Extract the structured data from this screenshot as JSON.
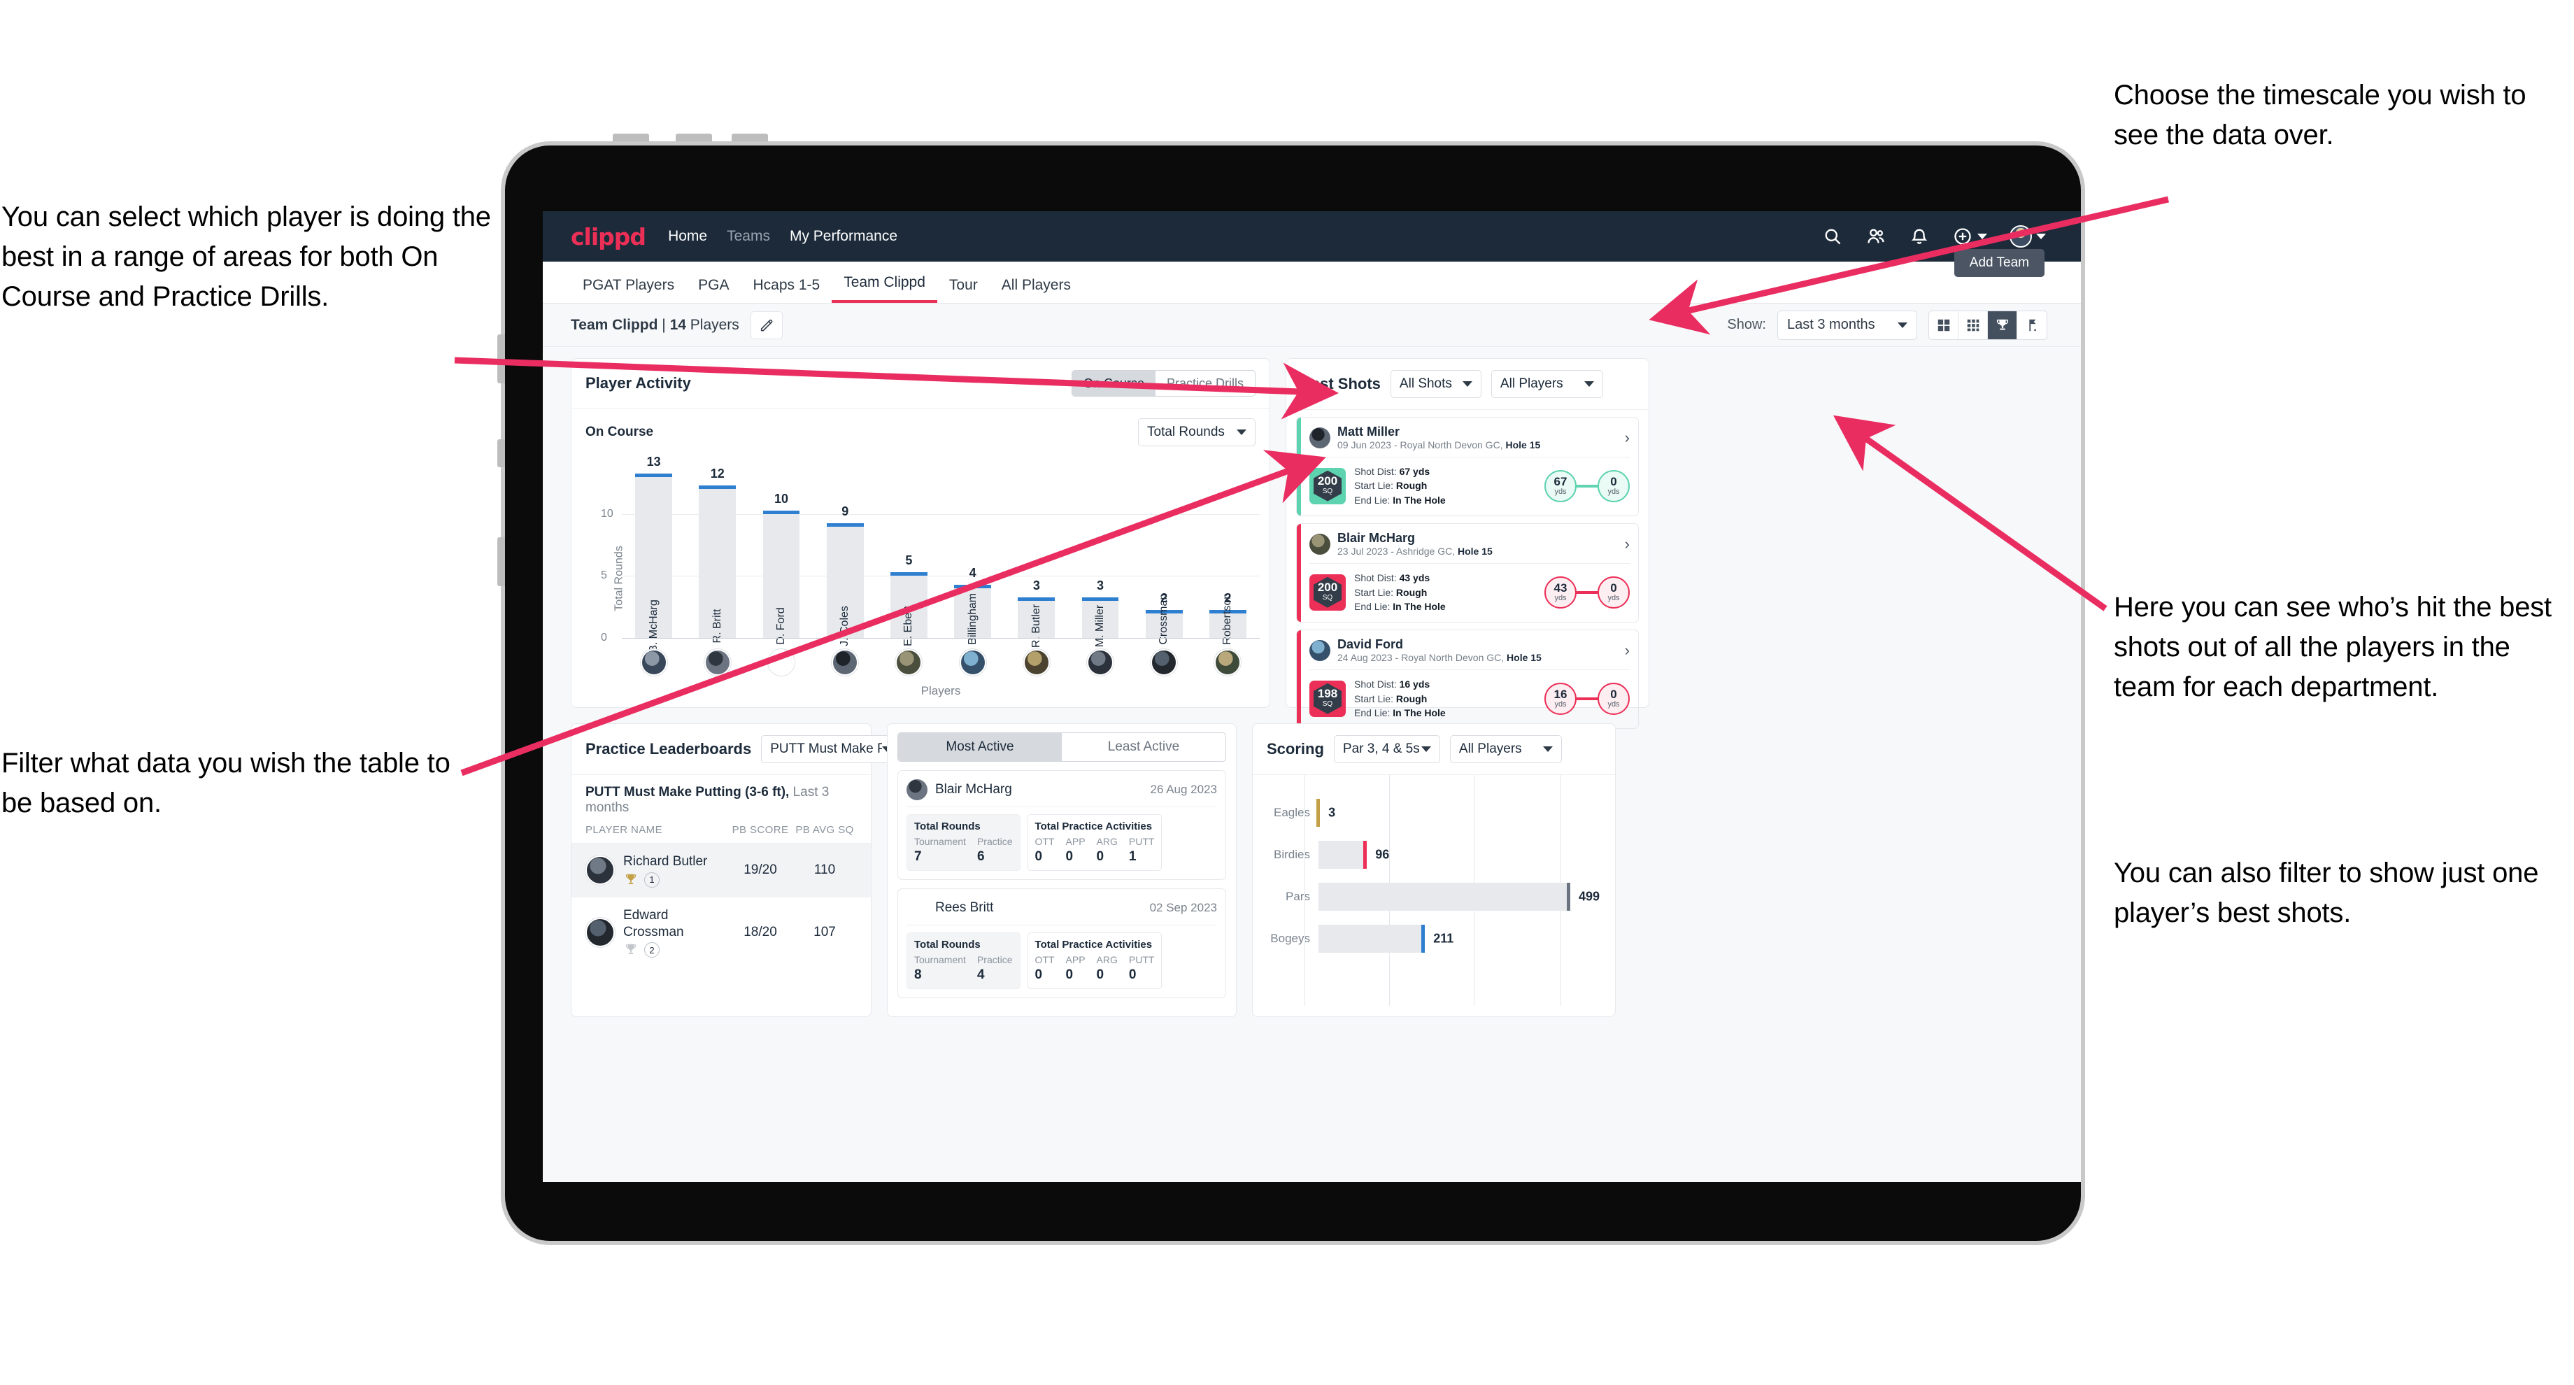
{
  "annotations": {
    "top_left": "You can select which player is doing the best in a range of areas for both On Course and Practice Drills.",
    "bottom_left": "Filter what data you wish the table to be based on.",
    "top_right": "Choose the timescale you wish to see the data over.",
    "right_1": "Here you can see who’s hit the best shots out of all the players in the team for each department.",
    "right_2": "You can also filter to show just one player’s best shots."
  },
  "colors": {
    "brand_pink": "#ec2f57",
    "nav_dark": "#1c2a3a",
    "bar_blue": "#2f7fd1",
    "teal": "#5ed3b0",
    "gold": "#c3a046",
    "arrow_pink": "#ea2d60"
  },
  "topnav": {
    "logo": "clippd",
    "links": [
      {
        "label": "Home",
        "dim": false
      },
      {
        "label": "Teams",
        "dim": true
      },
      {
        "label": "My Performance",
        "dim": false
      }
    ],
    "icons": [
      "search-icon",
      "people-icon",
      "bell-icon",
      "plus-circle-icon",
      "avatar-icon"
    ]
  },
  "tabs": {
    "items": [
      {
        "label": "PGAT Players",
        "active": false
      },
      {
        "label": "PGA",
        "active": false
      },
      {
        "label": "Hcaps 1-5",
        "active": false
      },
      {
        "label": "Team Clippd",
        "active": true
      },
      {
        "label": "Tour",
        "active": false
      },
      {
        "label": "All Players",
        "active": false
      }
    ],
    "add_team_tooltip": "Add Team"
  },
  "subbar": {
    "team_name": "Team Clippd",
    "separator": " | ",
    "player_count": "14",
    "players_word": " Players",
    "show_label": "Show:",
    "timescale": "Last 3 months",
    "view_buttons": [
      "grid-large-icon",
      "grid-small-icon",
      "trophy-icon",
      "flag-icon"
    ],
    "active_view": "trophy-icon"
  },
  "player_activity": {
    "title": "Player Activity",
    "segment": {
      "options": [
        "On Course",
        "Practice Drills"
      ],
      "selected": "On Course"
    },
    "subtitle": "On Course",
    "metric_select": "Total Rounds"
  },
  "chart_data": [
    {
      "type": "bar",
      "title": "Player Activity",
      "xlabel": "Players",
      "ylabel": "Total Rounds",
      "categories": [
        "B. McHarg",
        "R. Britt",
        "D. Ford",
        "J. Coles",
        "E. Ebert",
        "D. Billingham",
        "R. Butler",
        "M. Miller",
        "E. Crossman",
        "C. Robertson"
      ],
      "values": [
        13,
        12,
        10,
        9,
        5,
        4,
        3,
        3,
        2,
        2
      ],
      "ylim": [
        0,
        14
      ],
      "yticks": [
        0,
        5,
        10
      ],
      "grid": true,
      "bar_color": "#e7e9ec",
      "cap_color": "#2f7fd1"
    },
    {
      "type": "bar",
      "orientation": "horizontal",
      "title": "Scoring",
      "categories": [
        "Eagles",
        "Birdies",
        "Pars",
        "Bogeys"
      ],
      "values": [
        3,
        96,
        499,
        211
      ],
      "cap_colors": [
        "#c3a046",
        "#ec2f57",
        "#6b7280",
        "#2f7fd1"
      ],
      "xlim": [
        0,
        560
      ],
      "grid": true
    }
  ],
  "best_shots": {
    "title": "Best Shots",
    "shot_filter": "All Shots",
    "player_filter": "All Players",
    "cards": [
      {
        "name": "Matt Miller",
        "meta_plain": "09 Jun 2023 - Royal North Devon GC, ",
        "meta_bold": "Hole 15",
        "badge_value": "200",
        "badge_unit": "SQ",
        "accent": "#5ed3b0",
        "shot_dist_label": "Shot Dist: ",
        "shot_dist": "67 yds",
        "start_lie_label": "Start Lie: ",
        "start_lie": "Rough",
        "end_lie_label": "End Lie: ",
        "end_lie": "In The Hole",
        "from_value": "67",
        "from_unit": "yds",
        "to_value": "0",
        "to_unit": "yds"
      },
      {
        "name": "Blair McHarg",
        "meta_plain": "23 Jul 2023 - Ashridge GC, ",
        "meta_bold": "Hole 15",
        "badge_value": "200",
        "badge_unit": "SQ",
        "accent": "#ec2f57",
        "shot_dist_label": "Shot Dist: ",
        "shot_dist": "43 yds",
        "start_lie_label": "Start Lie: ",
        "start_lie": "Rough",
        "end_lie_label": "End Lie: ",
        "end_lie": "In The Hole",
        "from_value": "43",
        "from_unit": "yds",
        "to_value": "0",
        "to_unit": "yds"
      },
      {
        "name": "David Ford",
        "meta_plain": "24 Aug 2023 - Royal North Devon GC, ",
        "meta_bold": "Hole 15",
        "badge_value": "198",
        "badge_unit": "SQ",
        "accent": "#ec2f57",
        "shot_dist_label": "Shot Dist: ",
        "shot_dist": "16 yds",
        "start_lie_label": "Start Lie: ",
        "start_lie": "Rough",
        "end_lie_label": "End Lie: ",
        "end_lie": "In The Hole",
        "from_value": "16",
        "from_unit": "yds",
        "to_value": "0",
        "to_unit": "yds"
      }
    ]
  },
  "practice_leaderboards": {
    "title": "Practice Leaderboards",
    "drill_select": "PUTT Must Make Putting ...",
    "subtitle_bold": "PUTT Must Make Putting (3-6 ft),",
    "subtitle_plain": " Last 3 months",
    "columns": [
      "PLAYER NAME",
      "PB SCORE",
      "PB AVG SQ"
    ],
    "rows": [
      {
        "name": "Richard Butler",
        "rank": "1",
        "trophy": "gold",
        "pb_score": "19/20",
        "pb_avg_sq": "110"
      },
      {
        "name": "Edward Crossman",
        "rank": "2",
        "trophy": "silver",
        "pb_score": "18/20",
        "pb_avg_sq": "107"
      }
    ]
  },
  "activity": {
    "tabs": [
      "Most Active",
      "Least Active"
    ],
    "selected_tab": "Most Active",
    "cards": [
      {
        "name": "Blair McHarg",
        "date": "26 Aug 2023",
        "rounds_title": "Total Rounds",
        "rounds_cols": [
          "Tournament",
          "Practice"
        ],
        "rounds_vals": [
          "7",
          "6"
        ],
        "practice_title": "Total Practice Activities",
        "practice_cols": [
          "OTT",
          "APP",
          "ARG",
          "PUTT"
        ],
        "practice_vals": [
          "0",
          "0",
          "0",
          "1"
        ]
      },
      {
        "name": "Rees Britt",
        "date": "02 Sep 2023",
        "rounds_title": "Total Rounds",
        "rounds_cols": [
          "Tournament",
          "Practice"
        ],
        "rounds_vals": [
          "8",
          "4"
        ],
        "practice_title": "Total Practice Activities",
        "practice_cols": [
          "OTT",
          "APP",
          "ARG",
          "PUTT"
        ],
        "practice_vals": [
          "0",
          "0",
          "0",
          "0"
        ]
      }
    ]
  },
  "scoring": {
    "title": "Scoring",
    "par_filter": "Par 3, 4 & 5s",
    "player_filter": "All Players"
  }
}
